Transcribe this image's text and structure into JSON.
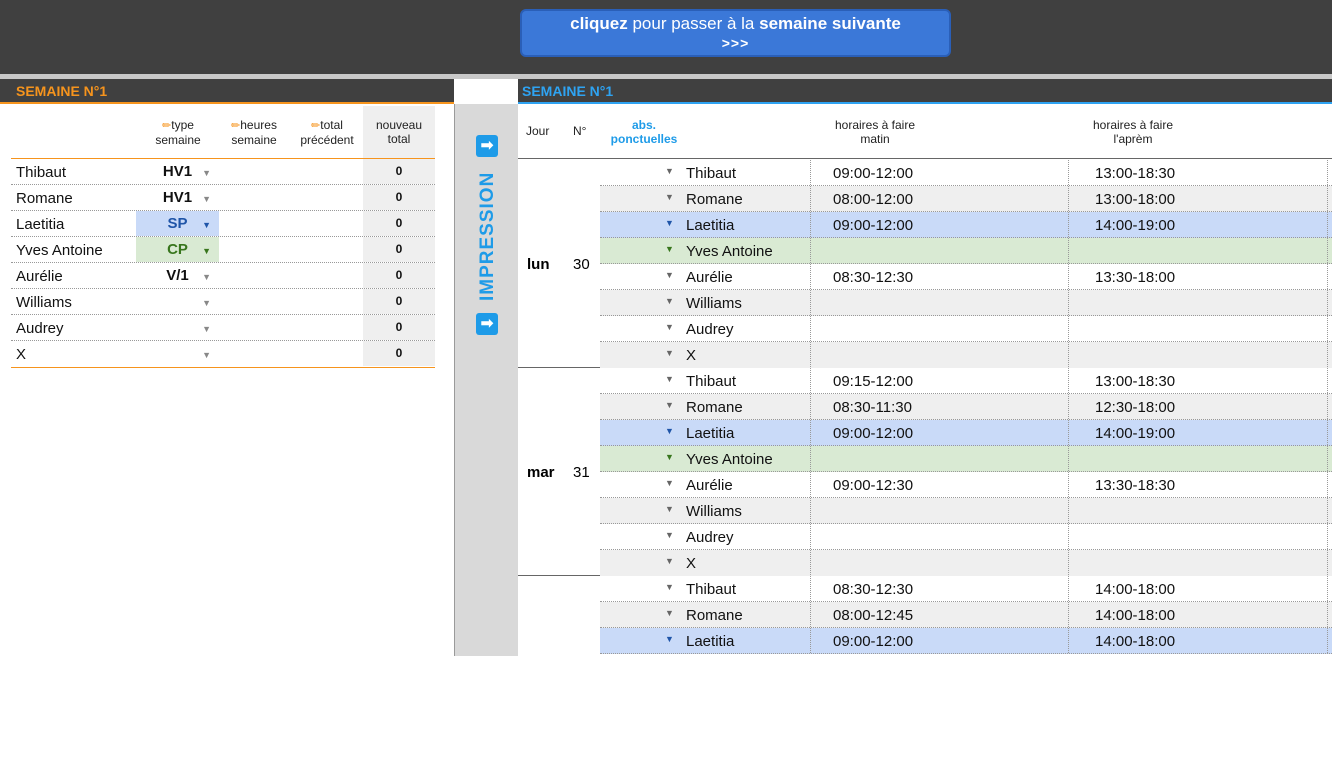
{
  "nav": {
    "next_week_bold1": "cliquez",
    "next_week_mid": " pour passer à la ",
    "next_week_bold2": "semaine suivante",
    "next_week_arrows": ">>>"
  },
  "left_panel": {
    "week_title": "SEMAINE N°1",
    "headers": {
      "type_line1": "type",
      "type_line2": "semaine",
      "hours_line1": "heures",
      "hours_line2": "semaine",
      "prev_line1": "total",
      "prev_line2": "précédent",
      "new_line1": "nouveau",
      "new_line2": "total"
    },
    "rows": [
      {
        "name": "Thibaut",
        "type": "HV1",
        "total": "0"
      },
      {
        "name": "Romane",
        "type": "HV1",
        "total": "0"
      },
      {
        "name": "Laetitia",
        "type": "SP",
        "total": "0"
      },
      {
        "name": "Yves Antoine",
        "type": "CP",
        "total": "0"
      },
      {
        "name": "Aurélie",
        "type": "V/1",
        "total": "0"
      },
      {
        "name": "Williams",
        "type": "",
        "total": "0"
      },
      {
        "name": "Audrey",
        "type": "",
        "total": "0"
      },
      {
        "name": "X",
        "type": "",
        "total": "0"
      }
    ]
  },
  "print_strip": {
    "label": "IMPRESSION",
    "arrow": "➡"
  },
  "right_panel": {
    "week_title": "SEMAINE N°1",
    "headers": {
      "day": "Jour",
      "num": "N°",
      "abs_line1": "abs.",
      "abs_line2": "ponctuelles",
      "am_line1": "horaires à faire",
      "am_line2": "matin",
      "pm_line1": "horaires à faire",
      "pm_line2": "l'aprèm"
    },
    "days": [
      {
        "day": "lun",
        "num": "30",
        "rows": [
          {
            "name": "Thibaut",
            "am": "09:00-12:00",
            "pm": "13:00-18:30"
          },
          {
            "name": "Romane",
            "am": "08:00-12:00",
            "pm": "13:00-18:00"
          },
          {
            "name": "Laetitia",
            "am": "09:00-12:00",
            "pm": "14:00-19:00"
          },
          {
            "name": "Yves Antoine",
            "am": "",
            "pm": ""
          },
          {
            "name": "Aurélie",
            "am": "08:30-12:30",
            "pm": "13:30-18:00"
          },
          {
            "name": "Williams",
            "am": "",
            "pm": ""
          },
          {
            "name": "Audrey",
            "am": "",
            "pm": ""
          },
          {
            "name": "X",
            "am": "",
            "pm": ""
          }
        ]
      },
      {
        "day": "mar",
        "num": "31",
        "rows": [
          {
            "name": "Thibaut",
            "am": "09:15-12:00",
            "pm": "13:00-18:30"
          },
          {
            "name": "Romane",
            "am": "08:30-11:30",
            "pm": "12:30-18:00"
          },
          {
            "name": "Laetitia",
            "am": "09:00-12:00",
            "pm": "14:00-19:00"
          },
          {
            "name": "Yves Antoine",
            "am": "",
            "pm": ""
          },
          {
            "name": "Aurélie",
            "am": "09:00-12:30",
            "pm": "13:30-18:30"
          },
          {
            "name": "Williams",
            "am": "",
            "pm": ""
          },
          {
            "name": "Audrey",
            "am": "",
            "pm": ""
          },
          {
            "name": "X",
            "am": "",
            "pm": ""
          }
        ]
      },
      {
        "day": "",
        "num": "",
        "rows": [
          {
            "name": "Thibaut",
            "am": "08:30-12:30",
            "pm": "14:00-18:00"
          },
          {
            "name": "Romane",
            "am": "08:00-12:45",
            "pm": "14:00-18:00"
          },
          {
            "name": "Laetitia",
            "am": "09:00-12:00",
            "pm": "14:00-18:00"
          }
        ]
      }
    ]
  },
  "colors": {
    "orange": "#f6941d",
    "blue": "#2ea3f2",
    "sp_fill": "#c9daf8",
    "cp_fill": "#d9ead3"
  }
}
